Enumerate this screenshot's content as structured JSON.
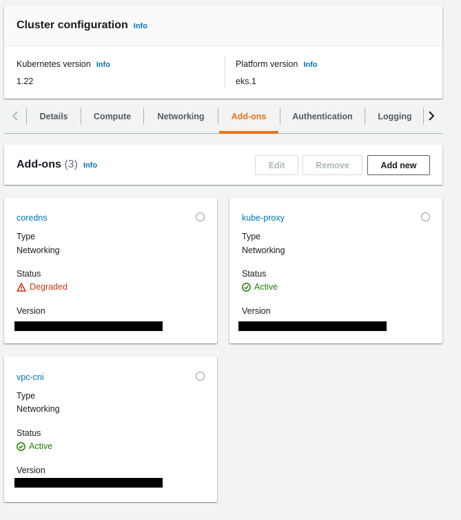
{
  "cluster_config": {
    "title": "Cluster configuration",
    "info": "Info",
    "kubernetes_version_label": "Kubernetes version",
    "kubernetes_version_value": "1.22",
    "platform_version_label": "Platform version",
    "platform_version_value": "eks.1"
  },
  "tabs": [
    {
      "label": "Details"
    },
    {
      "label": "Compute"
    },
    {
      "label": "Networking"
    },
    {
      "label": "Add-ons",
      "active": true
    },
    {
      "label": "Authentication"
    },
    {
      "label": "Logging"
    }
  ],
  "addons": {
    "title": "Add-ons",
    "count": "(3)",
    "info": "Info",
    "edit_label": "Edit",
    "remove_label": "Remove",
    "add_label": "Add new",
    "cards": [
      {
        "name": "coredns",
        "type_label": "Type",
        "type_value": "Networking",
        "status_label": "Status",
        "status_value": "Degraded",
        "status_icon": "warning-icon",
        "version_label": "Version"
      },
      {
        "name": "kube-proxy",
        "type_label": "Type",
        "type_value": "Networking",
        "status_label": "Status",
        "status_value": "Active",
        "status_icon": "check-circle-icon",
        "version_label": "Version"
      },
      {
        "name": "vpc-cni",
        "type_label": "Type",
        "type_value": "Networking",
        "status_label": "Status",
        "status_value": "Active",
        "status_icon": "check-circle-icon",
        "version_label": "Version"
      }
    ]
  },
  "colors": {
    "accent": "#ec7211",
    "link": "#0073bb",
    "error": "#d13212",
    "success": "#1d8102"
  }
}
